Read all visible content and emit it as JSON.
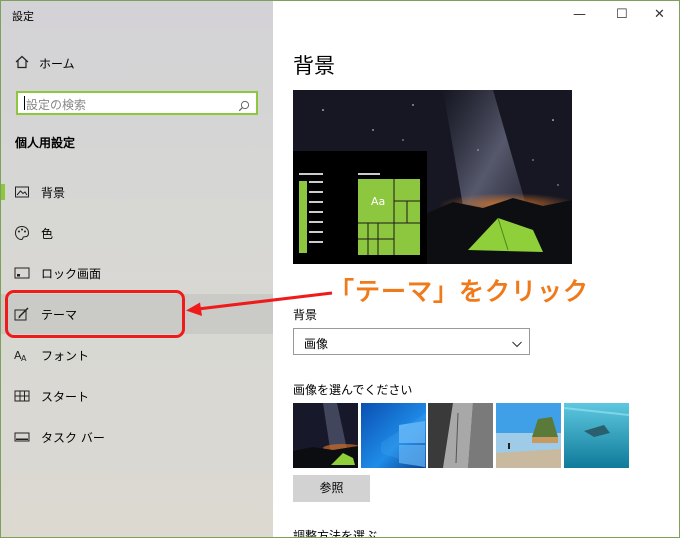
{
  "window": {
    "title": "設定",
    "minimize": "—",
    "maximize": "☐",
    "close": "✕"
  },
  "sidebar": {
    "home": {
      "label": "ホーム",
      "icon": "home-icon"
    },
    "search": {
      "placeholder": "設定の検索",
      "icon": "search-icon"
    },
    "section_title": "個人用設定",
    "items": [
      {
        "label": "背景",
        "icon": "picture-icon"
      },
      {
        "label": "色",
        "icon": "palette-icon"
      },
      {
        "label": "ロック画面",
        "icon": "lock-screen-icon"
      },
      {
        "label": "テーマ",
        "icon": "theme-brush-icon"
      },
      {
        "label": "フォント",
        "icon": "font-icon"
      },
      {
        "label": "スタート",
        "icon": "start-icon"
      },
      {
        "label": "タスク バー",
        "icon": "taskbar-icon"
      }
    ],
    "accent_color": "#8dc63f"
  },
  "main": {
    "title": "背景",
    "preview_sample_text": "Aa",
    "background_label": "背景",
    "background_value": "画像",
    "choose_picture_label": "画像を選んでください",
    "browse_label": "参照",
    "fit_label": "調整方法を選ぶ"
  },
  "annotation": {
    "text": "「テーマ」をクリック",
    "color": "#f07a1a",
    "highlight_color": "#ef1b1b"
  }
}
